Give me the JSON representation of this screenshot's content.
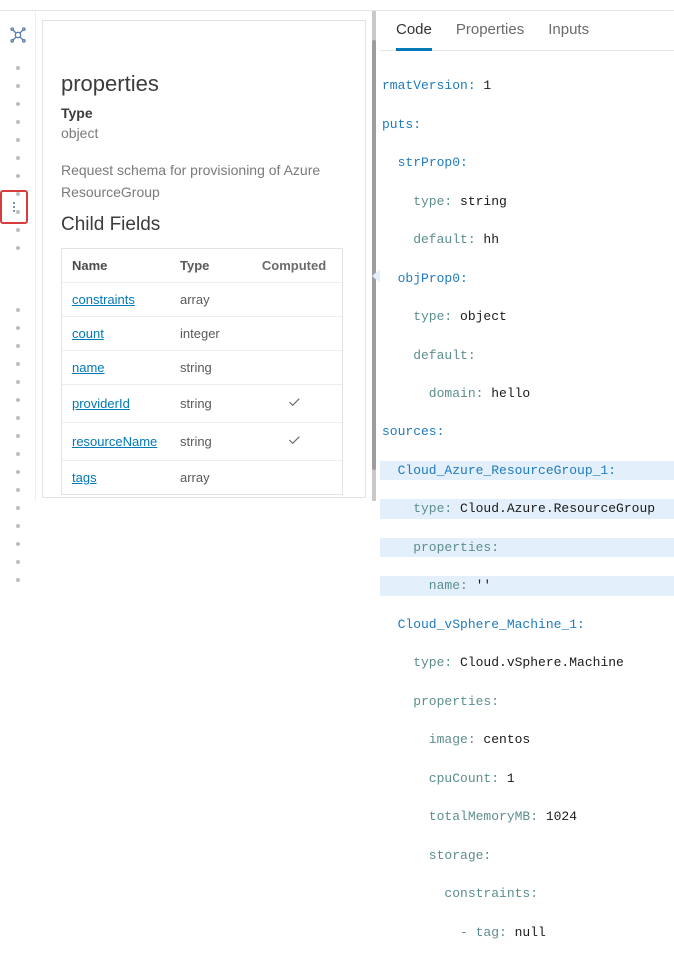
{
  "leftRail": {
    "mainIcon": "integration-icon",
    "menuIcon": "more-vertical-icon"
  },
  "panel": {
    "close": "×",
    "heading": "properties",
    "typeLabel": "Type",
    "typeValue": "object",
    "description": "Request schema for provisioning of Azure ResourceGroup",
    "childFieldsHeading": "Child Fields",
    "th": {
      "name": "Name",
      "type": "Type",
      "computed": "Computed"
    },
    "rows": [
      {
        "name": "constraints",
        "type": "array",
        "computed": false
      },
      {
        "name": "count",
        "type": "integer",
        "computed": false
      },
      {
        "name": "name",
        "type": "string",
        "computed": false
      },
      {
        "name": "providerId",
        "type": "string",
        "computed": true
      },
      {
        "name": "resourceName",
        "type": "string",
        "computed": true
      },
      {
        "name": "tags",
        "type": "array",
        "computed": false
      }
    ]
  },
  "tabs": {
    "code": "Code",
    "properties": "Properties",
    "inputs": "Inputs"
  },
  "code": {
    "l1": "rmatVersion:",
    "v1": " 1",
    "l2": "puts:",
    "l3": "strProp0:",
    "l4": "    type:",
    "v4": " string",
    "l5": "    default:",
    "v5": " hh",
    "l6": "objProp0:",
    "l7": "    type:",
    "v7": " object",
    "l8": "    default:",
    "l9": "      domain:",
    "v9": " hello",
    "l10": "sources:",
    "l11": "  Cloud_Azure_ResourceGroup_1:",
    "l12": "    type:",
    "v12": " Cloud.Azure.ResourceGroup",
    "l13": "    properties:",
    "l14": "      name:",
    "v14": " ''",
    "l15": "  Cloud_vSphere_Machine_1:",
    "l16": "    type:",
    "v16": " Cloud.vSphere.Machine",
    "l17": "    properties:",
    "l18": "      image:",
    "v18": " centos",
    "l19": "      cpuCount:",
    "v19": " 1",
    "l20": "      totalMemoryMB:",
    "v20": " 1024",
    "l21": "      storage:",
    "l22": "        constraints:",
    "l23": "          - tag:",
    "v23": " null"
  }
}
